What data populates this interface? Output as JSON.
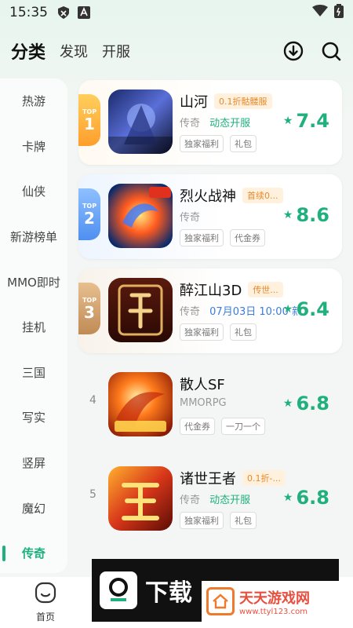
{
  "status_bar": {
    "time": "15:35"
  },
  "header": {
    "tabs": [
      {
        "label": "分类",
        "active": true
      },
      {
        "label": "发现",
        "active": false
      },
      {
        "label": "开服",
        "active": false
      }
    ]
  },
  "sidebar": {
    "items": [
      {
        "label": "热游"
      },
      {
        "label": "卡牌"
      },
      {
        "label": "仙侠"
      },
      {
        "label": "新游榜单"
      },
      {
        "label": "MMO即时"
      },
      {
        "label": "挂机"
      },
      {
        "label": "三国"
      },
      {
        "label": "写实"
      },
      {
        "label": "竖屏"
      },
      {
        "label": "魔幻"
      },
      {
        "label": "传奇",
        "active": true
      }
    ]
  },
  "games": [
    {
      "rank_word": "TOP",
      "rank": "1",
      "name": "山河",
      "promo": "0.1折骷髅服",
      "genre": "传奇",
      "highlight": "动态开服",
      "tags": [
        "独家福利",
        "礼包"
      ],
      "score": "7.4"
    },
    {
      "rank_word": "TOP",
      "rank": "2",
      "name": "烈火战神",
      "promo": "首续0...",
      "genre": "传奇",
      "highlight": "",
      "tags": [
        "独家福利",
        "代金券"
      ],
      "score": "8.6"
    },
    {
      "rank_word": "TOP",
      "rank": "3",
      "name": "醉江山3D",
      "promo": "传世...",
      "genre": "传奇",
      "highlight": "07月03日 10:00 新",
      "tags": [
        "独家福利",
        "礼包"
      ],
      "score": "6.4"
    },
    {
      "rank": "4",
      "name": "散人SF",
      "promo": "",
      "genre": "MMORPG",
      "highlight": "",
      "tags": [
        "代金券",
        "一刀一个"
      ],
      "score": "6.8"
    },
    {
      "rank": "5",
      "name": "诸世王者",
      "promo": "0.1折-...",
      "genre": "传奇",
      "highlight": "动态开服",
      "tags": [
        "独家福利",
        "礼包"
      ],
      "score": "6.8"
    }
  ],
  "bottom_nav": {
    "home_label": "首页"
  },
  "watermark": {
    "left_text": "下载",
    "right_title": "天天游戏网",
    "right_url": "www.ttyl123.com"
  },
  "colors": {
    "accent": "#1fb07d",
    "promo": "#e58a2b"
  }
}
